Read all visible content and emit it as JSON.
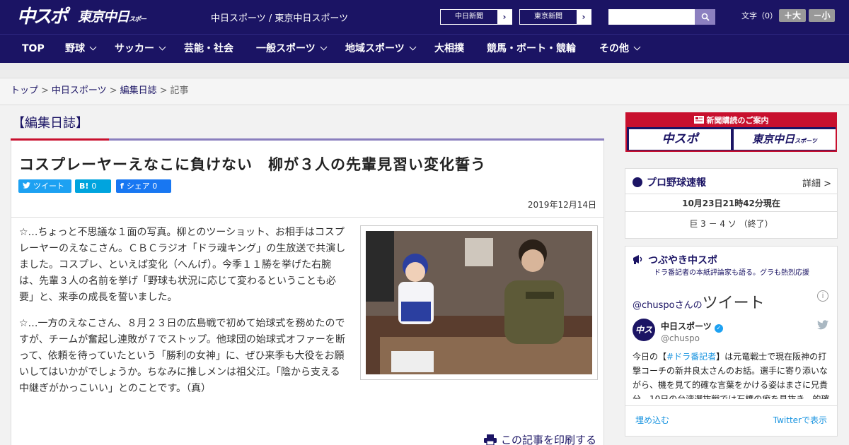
{
  "header": {
    "logo_chuspo": "中スポ",
    "logo_tokyo": "東京中日",
    "logo_tokyo_small": "スポーツ",
    "site_name": "中日スポーツ / 東京中日スポーツ",
    "ext_links": [
      {
        "label": "中日新聞",
        "arrow": "›"
      },
      {
        "label": "東京新聞",
        "arrow": "›"
      }
    ],
    "search_placeholder": "",
    "font_size_label": "文字（0）",
    "font_plus": "＋大",
    "font_minus": "－小"
  },
  "nav": {
    "items": [
      {
        "label": "TOP"
      },
      {
        "label": "野球"
      },
      {
        "label": "サッカー"
      },
      {
        "label": "芸能・社会"
      },
      {
        "label": "一般スポーツ"
      },
      {
        "label": "地域スポーツ"
      },
      {
        "label": "大相撲"
      },
      {
        "label": "競馬・ボート・競輪"
      },
      {
        "label": "その他"
      }
    ]
  },
  "breadcrumb": {
    "items": [
      "トップ",
      "中日スポーツ",
      "編集日誌"
    ],
    "current": "記事",
    "separator": ">"
  },
  "section": {
    "title": "【編集日誌】"
  },
  "article": {
    "headline": "コスプレーヤーえなこに負けない　柳が３人の先輩見習い変化誓う",
    "share": {
      "tweet": "ツイート",
      "hatena_icon": "B!",
      "hatena_count": "0",
      "fb_icon": "f",
      "fb_label": "シェア",
      "fb_count": "0"
    },
    "date": "2019年12月14日",
    "paragraphs": [
      "☆…ちょっと不思議な１面の写真。柳とのツーショット、お相手はコスプレーヤーのえなこさん。ＣＢＣラジオ「ドラ魂キング」の生放送で共演しました。コスプレ、といえば変化（へんげ）。今季１１勝を挙げた右腕は、先輩３人の名前を挙げ「野球も状況に応じて変わるということも必要」と、来季の成長を誓いました。",
      "☆…一方のえなこさん、８月２３日の広島戦で初めて始球式を務めたのですが、チームが奮起し連敗が７でストップ。他球団の始球式オファーを断って、依頼を待っていたという「勝利の女神」に、ぜひ来季も大役をお願いしてはいかがでしょうか。ちなみに推しメンは祖父江。「陰から支える中継ぎがかっこいい」とのことです。（真）"
    ],
    "print_label": "この記事を印刷する"
  },
  "sidebar": {
    "promo": {
      "head": "新聞購読のご案内",
      "box1": "中スポ",
      "box2": "東京中日",
      "box2_small": "スポーツ"
    },
    "baseball": {
      "title": "プロ野球速報",
      "detail": "詳細 >",
      "timestamp": "10月23日21時42分現在",
      "score": "巨 3 － 4 ソ （終了）"
    },
    "tsubuyaki": {
      "title": "つぶやき中スポ",
      "subtitle": "ドラ番記者の本紙評論家も語る。グラも熱烈応援",
      "account_prefix": "@chuspoさんの",
      "tweet_word": "ツイート",
      "info": "i",
      "avatar_text": "中スポ",
      "name": "中日スポーツ",
      "verified": "✓",
      "handle": "@chuspo",
      "text_pre": "今日の【",
      "text_tag": "#ドラ番記者",
      "text_post": "】は元竜戦士で現在阪神の打撃コーチの新井良太さんのお話。選手に寄り添いながら、機を見て的確な言葉をかける姿はまさに兄貴分。10日の台湾選抜戦では石橋の癖を見抜き、的確",
      "embed": "埋め込む",
      "view": "Twitterで表示"
    }
  }
}
